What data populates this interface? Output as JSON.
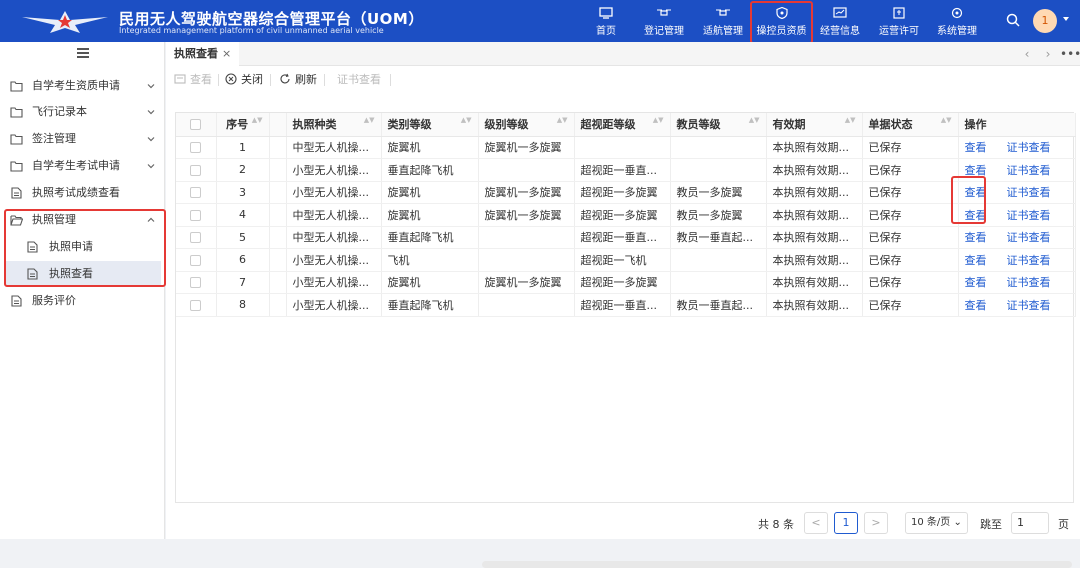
{
  "header": {
    "title": "民用无人驾驶航空器综合管理平台（UOM）",
    "subtitle": "Integrated management platform of civil unmanned aerial vehicle",
    "nav": [
      {
        "label": "首页",
        "icon": "monitor-icon"
      },
      {
        "label": "登记管理",
        "icon": "drone-icon"
      },
      {
        "label": "适航管理",
        "icon": "drone-icon"
      },
      {
        "label": "操控员资质",
        "icon": "shield-icon",
        "active": true
      },
      {
        "label": "经营信息",
        "icon": "chart-icon"
      },
      {
        "label": "运营许可",
        "icon": "permit-icon"
      },
      {
        "label": "系统管理",
        "icon": "settings-icon"
      }
    ],
    "avatar_text": "1"
  },
  "sidebar": {
    "items": [
      {
        "label": "自学考生资质申请",
        "icon": "folder-icon"
      },
      {
        "label": "飞行记录本",
        "icon": "folder-icon"
      },
      {
        "label": "签注管理",
        "icon": "folder-icon"
      },
      {
        "label": "自学考生考试申请",
        "icon": "folder-icon"
      },
      {
        "label": "执照考试成绩查看",
        "icon": "document-icon"
      },
      {
        "label": "执照管理",
        "icon": "folder-open-icon"
      },
      {
        "label": "执照申请",
        "icon": "document-icon"
      },
      {
        "label": "执照查看",
        "icon": "document-icon",
        "selected": true
      },
      {
        "label": "服务评价",
        "icon": "document-icon"
      }
    ]
  },
  "tabs": [
    {
      "label": "执照查看",
      "close": "×"
    }
  ],
  "toolbar": {
    "view": "查看",
    "close": "关闭",
    "refresh": "刷新",
    "cert_view": "证书查看"
  },
  "table": {
    "columns": [
      "序号",
      "执照种类",
      "类别等级",
      "级别等级",
      "超视距等级",
      "教员等级",
      "有效期",
      "单据状态",
      "操作"
    ],
    "rows": [
      [
        "1",
        "中型无人机操...",
        "旋翼机",
        "旋翼机一多旋翼",
        "",
        "",
        "本执照有效期...",
        "已保存"
      ],
      [
        "2",
        "小型无人机操...",
        "垂直起降飞机",
        "",
        "超视距一垂直...",
        "",
        "本执照有效期...",
        "已保存"
      ],
      [
        "3",
        "小型无人机操...",
        "旋翼机",
        "旋翼机一多旋翼",
        "超视距一多旋翼",
        "教员一多旋翼",
        "本执照有效期...",
        "已保存"
      ],
      [
        "4",
        "中型无人机操...",
        "旋翼机",
        "旋翼机一多旋翼",
        "超视距一多旋翼",
        "教员一多旋翼",
        "本执照有效期...",
        "已保存"
      ],
      [
        "5",
        "中型无人机操...",
        "垂直起降飞机",
        "",
        "超视距一垂直...",
        "教员一垂直起...",
        "本执照有效期...",
        "已保存"
      ],
      [
        "6",
        "小型无人机操...",
        "飞机",
        "",
        "超视距一飞机",
        "",
        "本执照有效期...",
        "已保存"
      ],
      [
        "7",
        "小型无人机操...",
        "旋翼机",
        "旋翼机一多旋翼",
        "超视距一多旋翼",
        "",
        "本执照有效期...",
        "已保存"
      ],
      [
        "8",
        "小型无人机操...",
        "垂直起降飞机",
        "",
        "超视距一垂直...",
        "教员一垂直起...",
        "本执照有效期...",
        "已保存"
      ]
    ],
    "action_view": "查看",
    "action_cert": "证书查看"
  },
  "pager": {
    "total": "共 8 条",
    "prev": "<",
    "page": "1",
    "next": ">",
    "size": "10 条/页",
    "goto_label": "跳至",
    "goto_value": "1",
    "goto_unit": "页"
  },
  "colors": {
    "header": "#1c4fc4",
    "link": "#1f5bd0",
    "highlight": "#e53935"
  }
}
